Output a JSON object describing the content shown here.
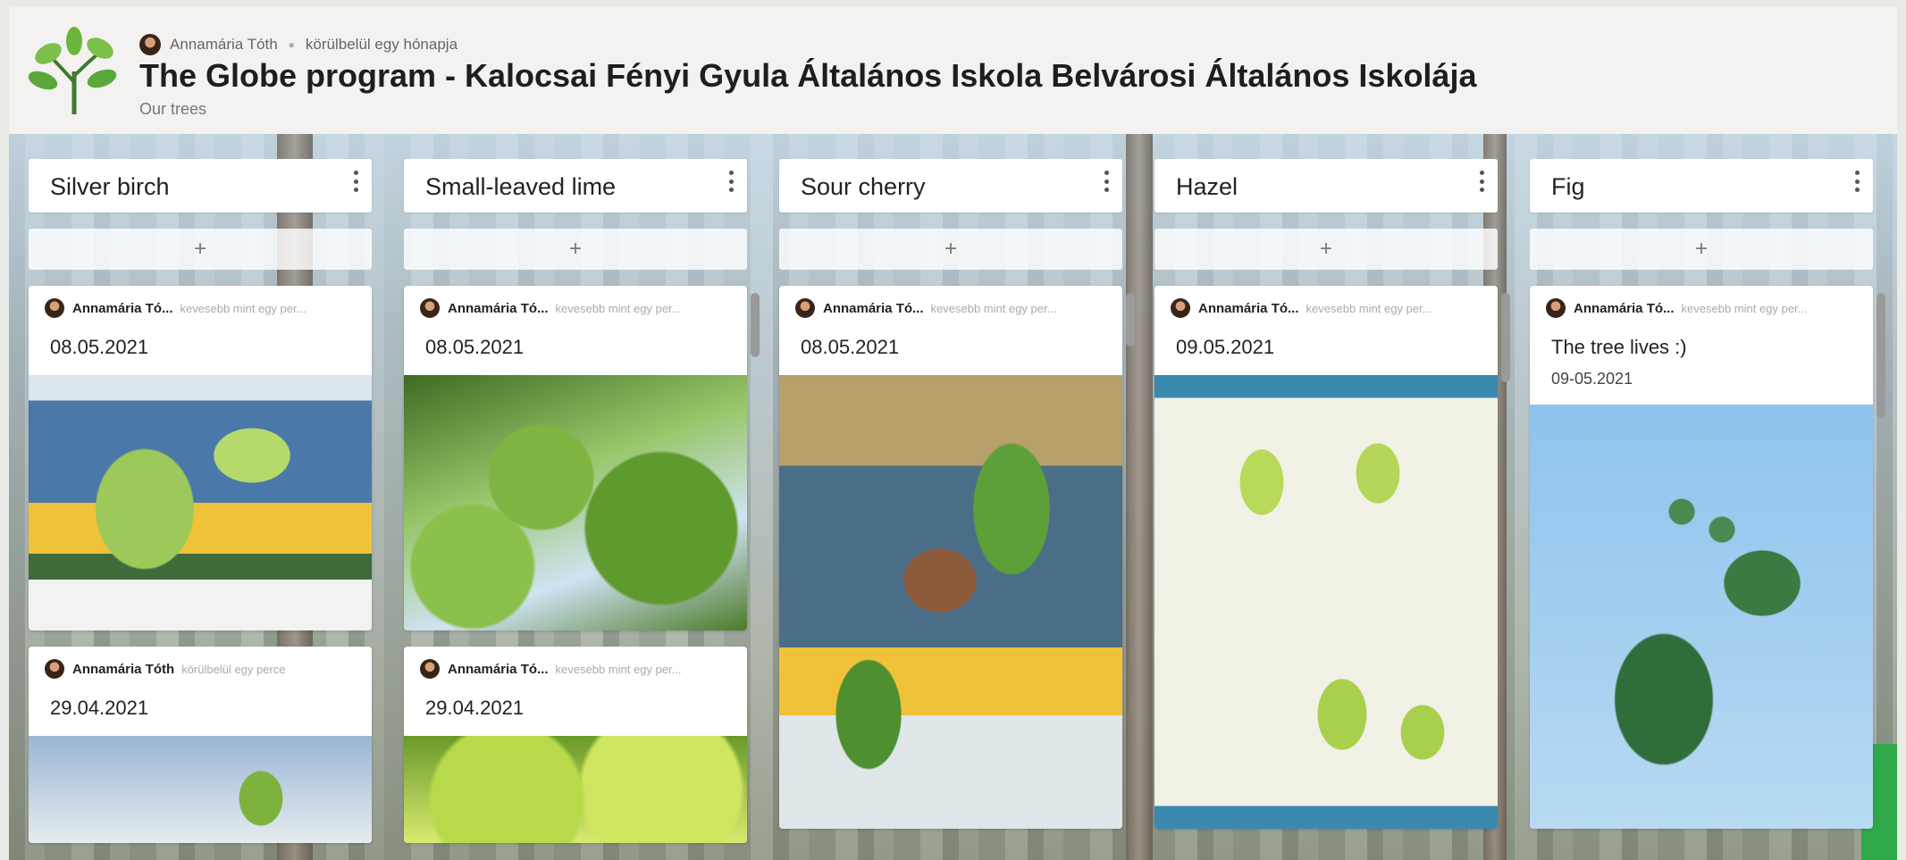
{
  "header": {
    "author": "Annamária Tóth",
    "time": "körülbelül egy hónapja",
    "title": "The Globe program - Kalocsai Fényi Gyula Általános Iskola Belvárosi Általános Iskolája",
    "subtitle": "Our trees"
  },
  "columns": [
    {
      "title": "Silver birch",
      "add": "+",
      "cards": [
        {
          "author": "Annamária Tó...",
          "time": "kevesebb mint egy per...",
          "text": "08.05.2021"
        },
        {
          "author": "Annamária Tóth",
          "time": "körülbelül egy perce",
          "text": "29.04.2021"
        }
      ]
    },
    {
      "title": "Small-leaved lime",
      "add": "+",
      "cards": [
        {
          "author": "Annamária Tó...",
          "time": "kevesebb mint egy per...",
          "text": "08.05.2021"
        },
        {
          "author": "Annamária Tó...",
          "time": "kevesebb mint egy per...",
          "text": "29.04.2021"
        }
      ]
    },
    {
      "title": "Sour cherry",
      "add": "+",
      "cards": [
        {
          "author": "Annamária Tó...",
          "time": "kevesebb mint egy per...",
          "text": "08.05.2021"
        }
      ]
    },
    {
      "title": "Hazel",
      "add": "+",
      "cards": [
        {
          "author": "Annamária Tó...",
          "time": "kevesebb mint egy per...",
          "text": "09.05.2021"
        }
      ]
    },
    {
      "title": "Fig",
      "add": "+",
      "cards": [
        {
          "author": "Annamária Tó...",
          "time": "kevesebb mint egy per...",
          "text": "The tree lives :)",
          "sub": "09-05.2021"
        }
      ]
    }
  ],
  "icons": {
    "logo": "tree-logo-icon",
    "menu": "kebab-menu-icon",
    "avatar": "avatar"
  },
  "colors": {
    "logo_green": "#5aa83a",
    "card_bg": "#ffffff",
    "header_bg": "#f3f2f0"
  }
}
